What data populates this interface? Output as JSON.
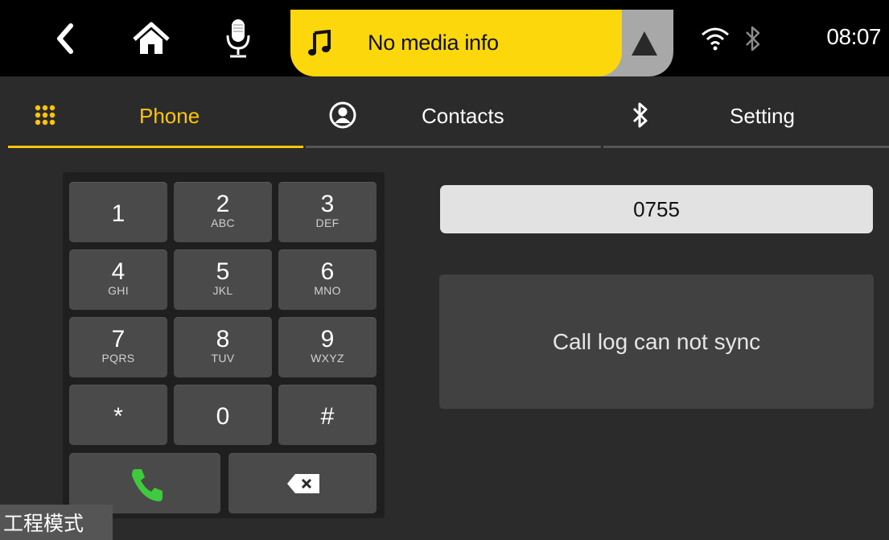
{
  "statusbar": {
    "icons": [
      "back-icon",
      "home-icon",
      "microphone-icon",
      "music-note-icon",
      "navigation-arrow-icon",
      "wifi-icon",
      "bluetooth-icon"
    ],
    "media_text": "No media info",
    "time": "08:07"
  },
  "tabs": [
    {
      "label": "Phone",
      "icon": "dialpad-icon",
      "active": true
    },
    {
      "label": "Contacts",
      "icon": "contact-icon",
      "active": false
    },
    {
      "label": "Setting",
      "icon": "bluetooth-icon",
      "active": false
    }
  ],
  "keypad": {
    "keys": [
      {
        "digit": "1",
        "letters": ""
      },
      {
        "digit": "2",
        "letters": "ABC"
      },
      {
        "digit": "3",
        "letters": "DEF"
      },
      {
        "digit": "4",
        "letters": "GHI"
      },
      {
        "digit": "5",
        "letters": "JKL"
      },
      {
        "digit": "6",
        "letters": "MNO"
      },
      {
        "digit": "7",
        "letters": "PQRS"
      },
      {
        "digit": "8",
        "letters": "TUV"
      },
      {
        "digit": "9",
        "letters": "WXYZ"
      },
      {
        "digit": "*",
        "letters": ""
      },
      {
        "digit": "0",
        "letters": ""
      },
      {
        "digit": "#",
        "letters": ""
      }
    ],
    "call_icon": "phone-call-icon",
    "delete_icon": "backspace-icon"
  },
  "dialer": {
    "number": "0755",
    "call_log_message": "Call log can not sync"
  },
  "footer": {
    "engineering_label": "工程模式"
  },
  "colors": {
    "accent": "#fcc50a",
    "media_pill": "#fcd70c",
    "call_green": "#3dcb3d",
    "background": "#2b2b2b",
    "key": "#4a4a4a"
  }
}
